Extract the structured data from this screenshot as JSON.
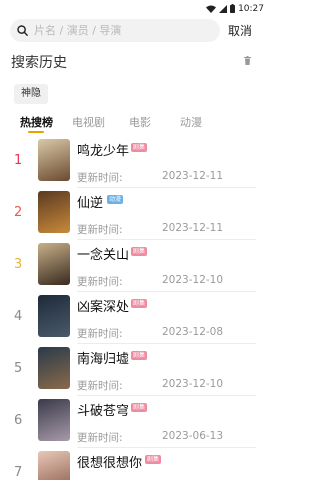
{
  "status_bar": {
    "time": "10:27"
  },
  "search": {
    "placeholder": "片名 / 演员 / 导演",
    "value": "",
    "cancel_label": "取消"
  },
  "history": {
    "title": "搜索历史",
    "chips": [
      "神隐"
    ]
  },
  "tabs": [
    {
      "label": "热搜榜",
      "active": true
    },
    {
      "label": "电视剧",
      "active": false
    },
    {
      "label": "电影",
      "active": false
    },
    {
      "label": "动漫",
      "active": false
    }
  ],
  "colors": {
    "tab_indicator": "#e8a200",
    "badge_pink": "#f08aa0",
    "badge_blue": "#6ab0e8"
  },
  "update_prefix": "更新时间:",
  "items": [
    {
      "rank": "1",
      "rank_color": "#e8355a",
      "title": "鸣龙少年",
      "badge": "剧集",
      "badge_color": "#f08aa0",
      "date": "2023-12-11",
      "poster_colors": [
        "#d9c9a8",
        "#6b4a2f"
      ]
    },
    {
      "rank": "2",
      "rank_color": "#e85a4a",
      "title": "仙逆",
      "badge": "动漫",
      "badge_color": "#6ab0e8",
      "date": "2023-12-11",
      "poster_colors": [
        "#5a3a22",
        "#c98a3a"
      ]
    },
    {
      "rank": "3",
      "rank_color": "#e8b43a",
      "title": "一念关山",
      "badge": "剧集",
      "badge_color": "#f08aa0",
      "date": "2023-12-10",
      "poster_colors": [
        "#c7b08a",
        "#3a2a1e"
      ]
    },
    {
      "rank": "4",
      "rank_color": "#8a8a8a",
      "title": "凶案深处",
      "badge": "剧集",
      "badge_color": "#f08aa0",
      "date": "2023-12-08",
      "poster_colors": [
        "#1e2a3a",
        "#4a5a6a"
      ]
    },
    {
      "rank": "5",
      "rank_color": "#8a8a8a",
      "title": "南海归墟",
      "badge": "剧集",
      "badge_color": "#f08aa0",
      "date": "2023-12-10",
      "poster_colors": [
        "#2a3a4a",
        "#8a6a4a"
      ]
    },
    {
      "rank": "6",
      "rank_color": "#8a8a8a",
      "title": "斗破苍穹",
      "badge": "剧集",
      "badge_color": "#f08aa0",
      "date": "2023-06-13",
      "poster_colors": [
        "#3a3a4a",
        "#a89aa8"
      ]
    },
    {
      "rank": "7",
      "rank_color": "#8a8a8a",
      "title": "很想很想你",
      "badge": "剧集",
      "badge_color": "#f08aa0",
      "date": "",
      "poster_colors": [
        "#e8c8b8",
        "#8a5a4a"
      ]
    }
  ]
}
